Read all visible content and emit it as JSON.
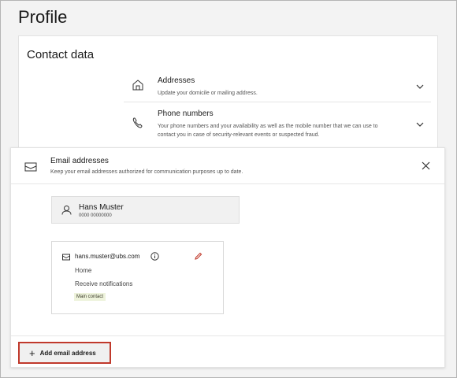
{
  "page": {
    "title": "Profile"
  },
  "contact": {
    "title": "Contact data",
    "sections": [
      {
        "title": "Addresses",
        "description": "Update your domicile or mailing address.",
        "icon": "house-icon"
      },
      {
        "title": "Phone numbers",
        "description": "Your phone numbers and your availability as well as the mobile number that we can use to contact you in case of security-relevant events or suspected fraud.",
        "icon": "phone-icon"
      }
    ]
  },
  "email_panel": {
    "title": "Email addresses",
    "description": "Keep your email addresses authorized for communication purposes up to date.",
    "person": {
      "name": "Hans Muster",
      "number": "0000 00000000"
    },
    "email": {
      "address": "hans.muster@ubs.com",
      "type": "Home",
      "notifications": "Receive notifications",
      "badge": "Main contact"
    },
    "add_button": "Add email address",
    "add_icon": "+"
  },
  "colors": {
    "highlight_border": "#c0392b",
    "badge_bg": "#eef3dc",
    "edit_icon": "#c0392b"
  }
}
